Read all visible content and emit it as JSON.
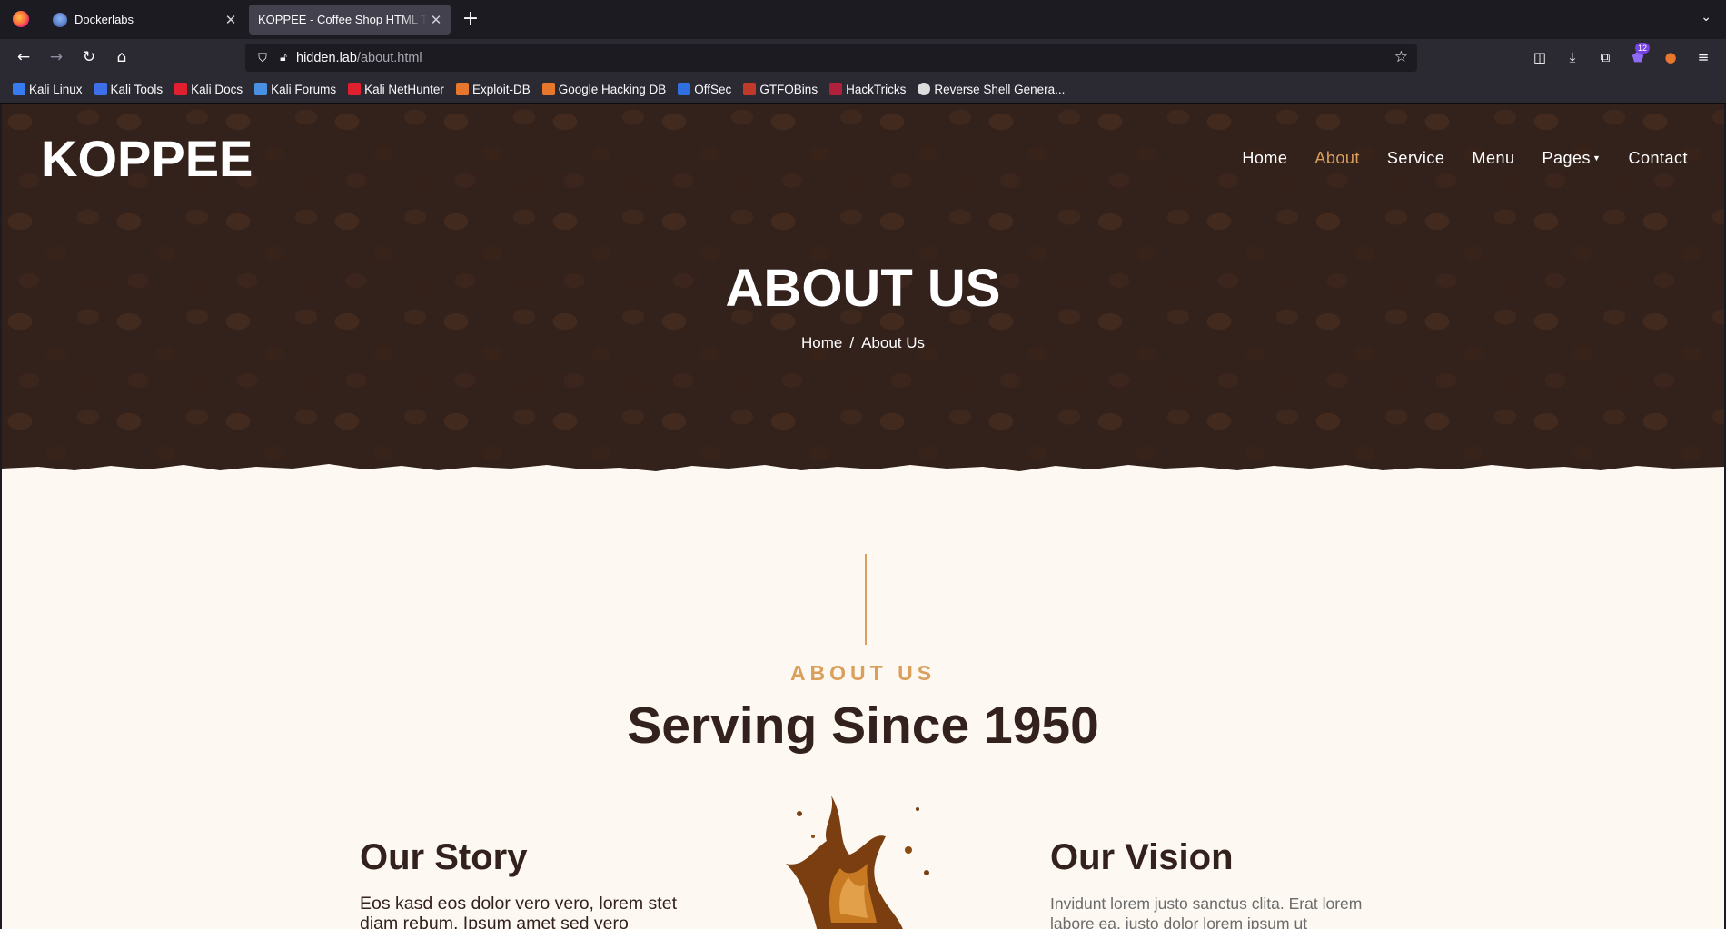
{
  "browser": {
    "tabs": [
      {
        "title": "Dockerlabs",
        "active": false
      },
      {
        "title": "KOPPEE - Coffee Shop HTML Template",
        "active": true
      }
    ],
    "url": {
      "host": "hidden.lab",
      "path": "/about.html"
    },
    "extension_badge": "12",
    "bookmarks": [
      {
        "label": "Kali Linux",
        "icon": "kali-dragon-icon",
        "color": "#367bf0"
      },
      {
        "label": "Kali Tools",
        "icon": "kali-tools-icon",
        "color": "#3d6fe8"
      },
      {
        "label": "Kali Docs",
        "icon": "kali-docs-icon",
        "color": "#e0202f"
      },
      {
        "label": "Kali Forums",
        "icon": "kali-forums-icon",
        "color": "#4a90e2"
      },
      {
        "label": "Kali NetHunter",
        "icon": "nethunter-icon",
        "color": "#e0202f"
      },
      {
        "label": "Exploit-DB",
        "icon": "exploit-db-icon",
        "color": "#e8772e"
      },
      {
        "label": "Google Hacking DB",
        "icon": "ghdb-icon",
        "color": "#e8772e"
      },
      {
        "label": "OffSec",
        "icon": "offsec-icon",
        "color": "#2f6fe0"
      },
      {
        "label": "GTFOBins",
        "icon": "gtfobins-icon",
        "color": "#c0392b"
      },
      {
        "label": "HackTricks",
        "icon": "hacktricks-icon",
        "color": "#b0203a"
      },
      {
        "label": "Reverse Shell Genera...",
        "icon": "skull-icon",
        "color": "#dddddd"
      }
    ]
  },
  "site": {
    "brand": "KOPPEE",
    "nav": [
      {
        "label": "Home",
        "active": false
      },
      {
        "label": "About",
        "active": true
      },
      {
        "label": "Service",
        "active": false
      },
      {
        "label": "Menu",
        "active": false
      },
      {
        "label": "Pages",
        "active": false,
        "dropdown": true
      },
      {
        "label": "Contact",
        "active": false
      }
    ],
    "hero": {
      "title": "ABOUT US",
      "breadcrumb": {
        "home": "Home",
        "separator": "/",
        "current": "About Us"
      }
    },
    "about": {
      "eyebrow": "ABOUT US",
      "heading": "Serving Since 1950",
      "story": {
        "title": "Our Story",
        "text": "Eos kasd eos dolor vero vero, lorem stet diam rebum. Ipsum amet sed vero"
      },
      "vision": {
        "title": "Our Vision",
        "text": "Invidunt lorem justo sanctus clita. Erat lorem labore ea, justo dolor lorem ipsum ut"
      }
    },
    "colors": {
      "accent": "#da9f5b",
      "dark": "#33211d",
      "cream": "#fdf9f2"
    }
  }
}
